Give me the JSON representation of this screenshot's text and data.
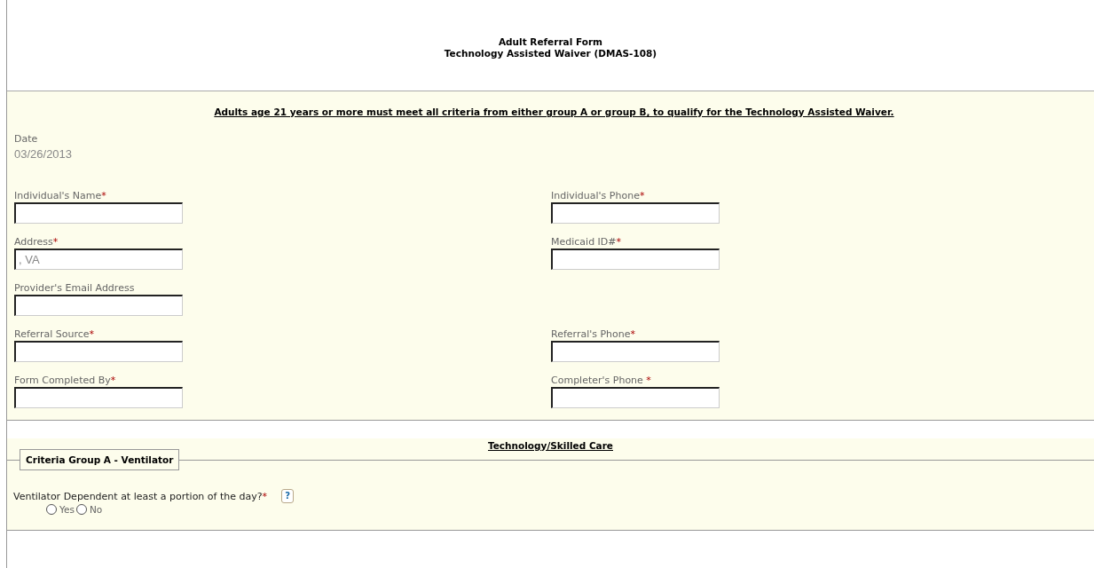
{
  "header": {
    "title_lines": [
      "Adult Referral Form",
      "Technology Assisted Waiver (DMAS-108)"
    ]
  },
  "notice": "Adults age 21 years or more must meet all criteria from either group A or group B, to qualify for the Technology Assisted Waiver.",
  "date": {
    "label": "Date",
    "value": "03/26/2013"
  },
  "field_rows": [
    {
      "left": {
        "label": "Individual's Name",
        "mark": "*"
      },
      "right": {
        "label": "Individual's Phone",
        "mark": "*"
      }
    },
    {
      "left": {
        "label": "Address",
        "mark": "*",
        "value": ", VA"
      },
      "right": {
        "label": "Medicaid ID#",
        "mark": "*"
      }
    },
    {
      "left": {
        "label": "Provider's Email Address"
      }
    },
    {
      "left": {
        "label": "Referral Source",
        "mark": "*"
      },
      "right": {
        "label": "Referral's Phone",
        "mark": "*"
      }
    },
    {
      "left": {
        "label": "Form Completed By",
        "mark": "*"
      },
      "right": {
        "label": "Completer's Phone ",
        "mark": "*"
      }
    }
  ],
  "section": {
    "title": "Technology/Skilled Care",
    "group_legend": "Criteria Group A - Ventilator",
    "question": {
      "text": "Ventilator Dependent at least a portion of the day?",
      "mark": "*",
      "help": "?",
      "options": [
        {
          "label": "Yes",
          "selected": false
        },
        {
          "label": "No",
          "selected": false
        }
      ]
    }
  }
}
